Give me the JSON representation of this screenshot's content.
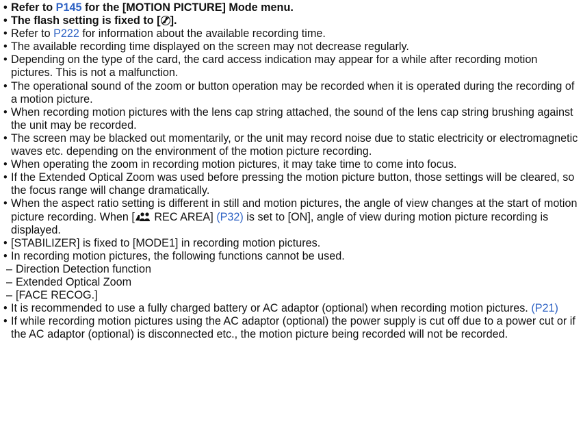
{
  "bullet_glyph": "•",
  "dash_glyph": "–",
  "icons": {
    "flash_off": "flash-off-icon",
    "motion_picture": "motion-picture-icon"
  },
  "colors": {
    "link": "#2f63c4",
    "text": "#111111"
  },
  "items": {
    "i0": {
      "a": "Refer to ",
      "link": "P145",
      "b": " for the [MOTION PICTURE] Mode menu."
    },
    "i1": {
      "a": "The flash setting is fixed to [",
      "b": "]."
    },
    "i2": {
      "a": "Refer to ",
      "link": "P222",
      "b": " for information about the available recording time."
    },
    "i3": {
      "text": "The available recording time displayed on the screen may not decrease regularly."
    },
    "i4": {
      "text": "Depending on the type of the card, the card access indication may appear for a while after recording motion pictures. This is not a malfunction."
    },
    "i5": {
      "text": "The operational sound of the zoom or button operation may be recorded when it is operated during the recording of a motion picture."
    },
    "i6": {
      "text": "When recording motion pictures with the lens cap string attached, the sound of the lens cap string brushing against the unit may be recorded."
    },
    "i7": {
      "text": "The screen may be blacked out momentarily, or the unit may record noise due to static electricity or electromagnetic waves etc. depending on the environment of the motion picture recording."
    },
    "i8": {
      "text": "When operating the zoom in recording motion pictures, it may take time to come into focus."
    },
    "i9": {
      "text": "If the Extended Optical Zoom was used before pressing the motion picture button, those settings will be cleared, so the focus range will change dramatically."
    },
    "i10": {
      "a": "When the aspect ratio setting is different in still and motion pictures, the angle of view changes at the start of motion picture recording. When [",
      "b": " REC AREA] ",
      "link": "(P32)",
      "c": " is set to [ON], angle of view during motion picture recording is displayed."
    },
    "i11": {
      "text": "[STABILIZER] is fixed to [MODE1] in recording motion pictures."
    },
    "i12": {
      "text": "In recording motion pictures, the following functions cannot be used.",
      "subs": {
        "s0": "Direction Detection function",
        "s1": "Extended Optical Zoom",
        "s2": "[FACE RECOG.]"
      }
    },
    "i13": {
      "a": "It is recommended to use a fully charged battery or AC adaptor (optional) when recording motion pictures. ",
      "link": "(P21)"
    },
    "i14": {
      "text": "If while recording motion pictures using the AC adaptor (optional) the power supply is cut off due to a power cut or if the AC adaptor (optional) is disconnected etc., the motion picture being recorded will not be recorded."
    }
  }
}
